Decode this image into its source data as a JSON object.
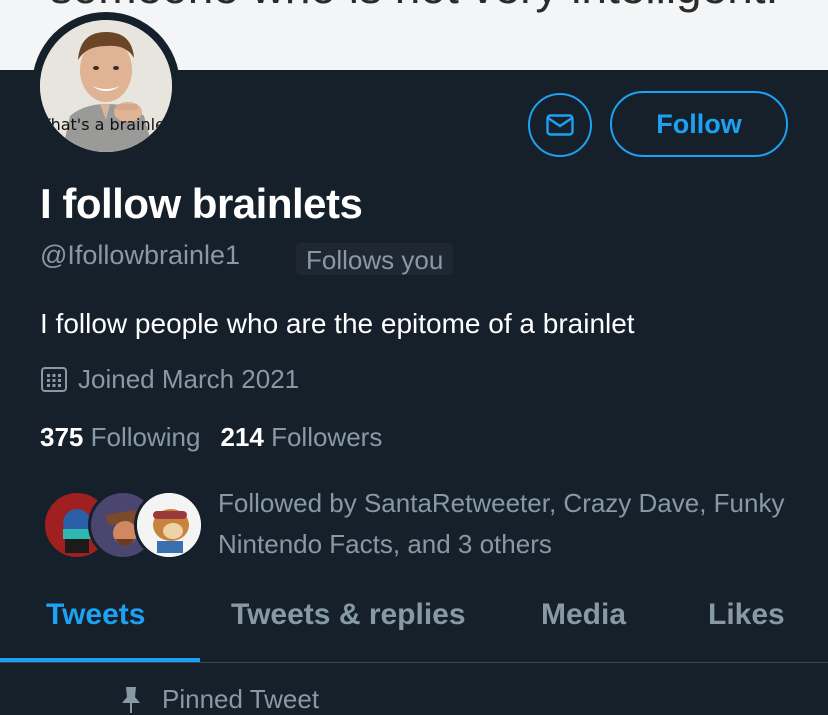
{
  "banner": {
    "text": "someone who is not very intelligent."
  },
  "profile": {
    "avatar_caption": "That's a brainlet",
    "display_name": "I follow brainlets",
    "handle": "@Ifollowbrainle1",
    "follows_you": "Follows you",
    "bio": "I follow people who are the epitome of a brainlet",
    "joined": "Joined March 2021",
    "following_count": "375",
    "following_label": "Following",
    "followers_count": "214",
    "followers_label": "Followers",
    "followed_by": "Followed by SantaRetweeter, Crazy Dave, Funky Nintendo Facts, and 3 others"
  },
  "actions": {
    "message_icon": "envelope-icon",
    "follow_label": "Follow"
  },
  "tabs": [
    {
      "label": "Tweets",
      "active": true
    },
    {
      "label": "Tweets & replies",
      "active": false
    },
    {
      "label": "Media",
      "active": false
    },
    {
      "label": "Likes",
      "active": false
    }
  ],
  "pinned": {
    "label": "Pinned Tweet",
    "icon": "pin-icon"
  },
  "colors": {
    "background": "#15202b",
    "accent": "#1da1f2",
    "secondary_text": "#8899a6"
  }
}
